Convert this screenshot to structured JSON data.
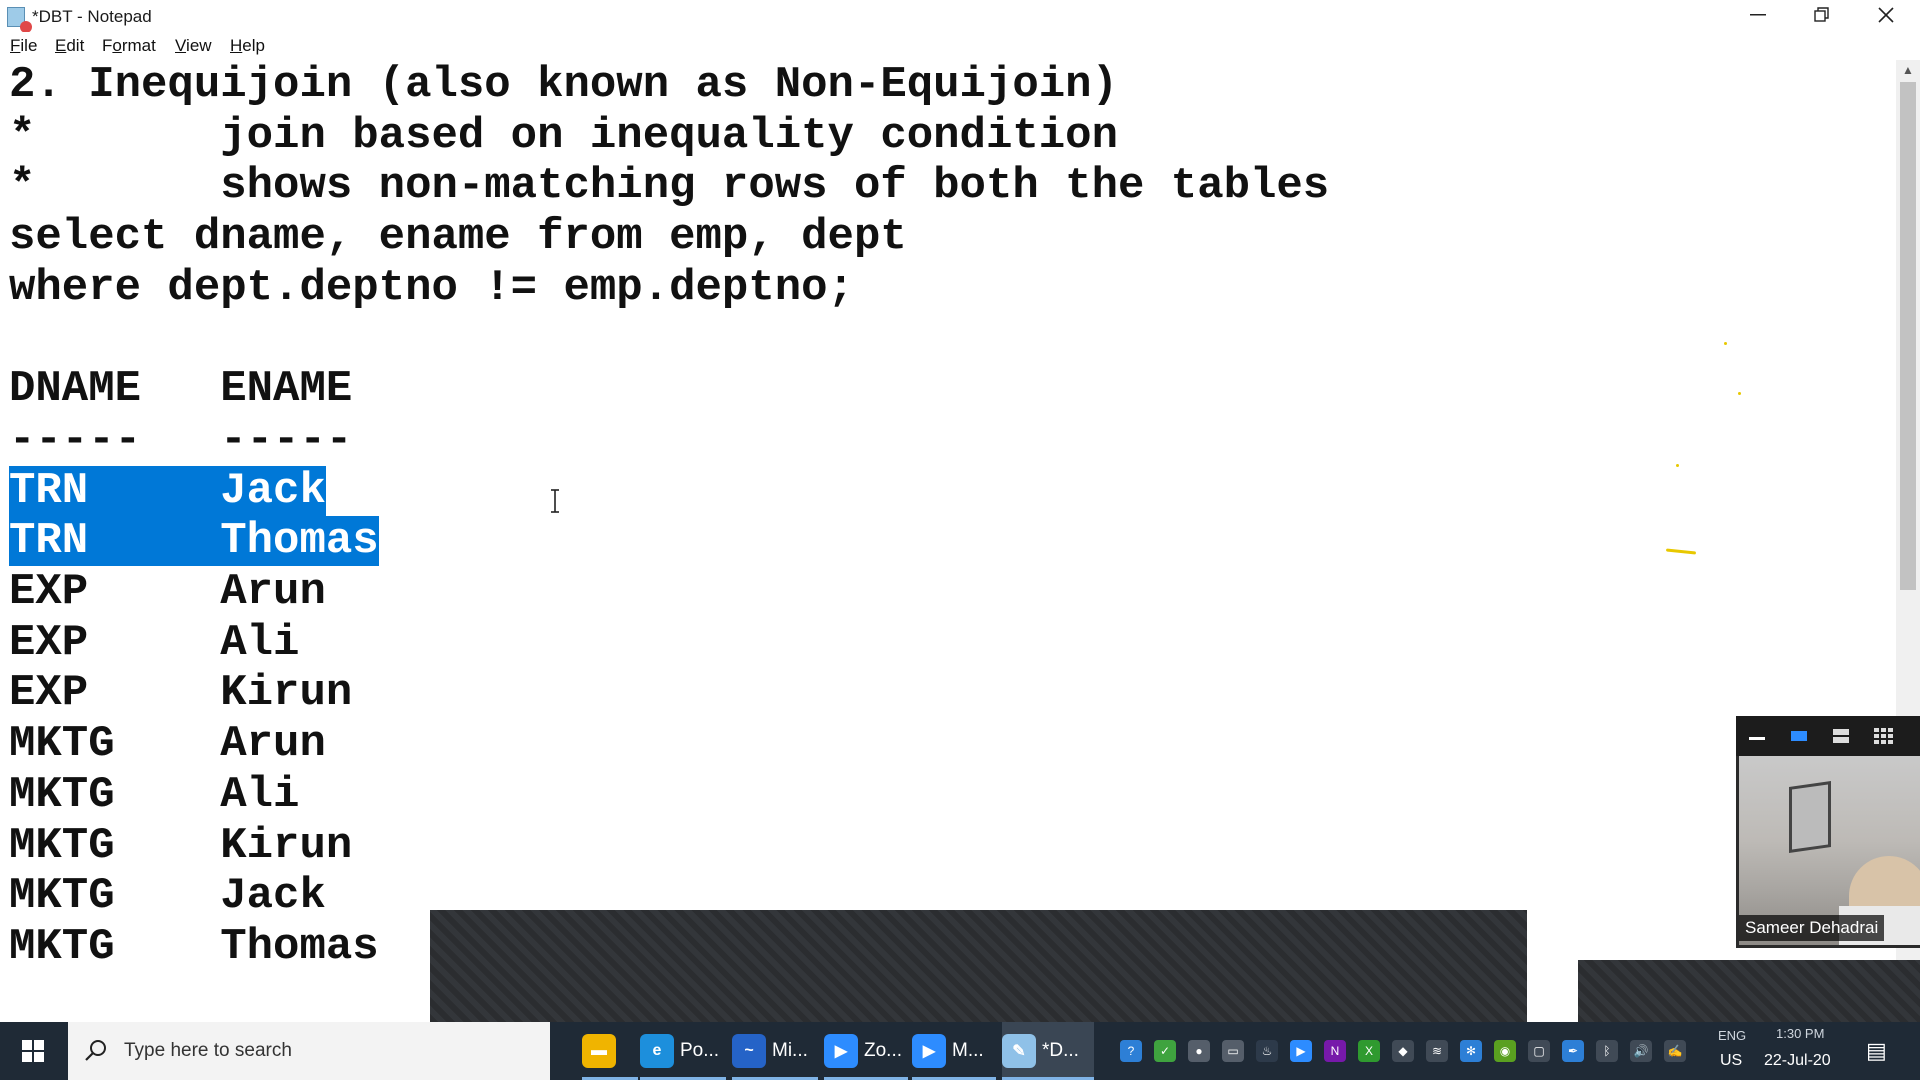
{
  "window": {
    "title": "*DBT - Notepad",
    "minimize_glyph": "—",
    "restore_glyph": "❐",
    "close_glyph": "✕"
  },
  "menu": [
    {
      "prefix": "",
      "hotkey": "F",
      "rest": "ile"
    },
    {
      "prefix": "",
      "hotkey": "E",
      "rest": "dit"
    },
    {
      "prefix": "F",
      "hotkey": "o",
      "rest": "rmat"
    },
    {
      "prefix": "",
      "hotkey": "V",
      "rest": "iew"
    },
    {
      "prefix": "",
      "hotkey": "H",
      "rest": "elp"
    }
  ],
  "editor": {
    "lines": [
      "2. Inequijoin (also known as Non-Equijoin)",
      "*       join based on inequality condition",
      "*       shows non-matching rows of both the tables",
      "select dname, ename from emp, dept",
      "where dept.deptno != emp.deptno;",
      "",
      "DNAME   ENAME",
      "-----   -----",
      "TRN     Jack",
      "TRN     Thomas",
      "EXP     Arun",
      "EXP     Ali",
      "EXP     Kirun",
      "MKTG    Arun",
      "MKTG    Ali",
      "MKTG    Kirun",
      "MKTG    Jack",
      "MKTG    Thomas"
    ],
    "selected_lines": [
      8,
      9
    ],
    "selection_color": "#0078d7"
  },
  "video": {
    "participant_name": "Sameer Dehadrai"
  },
  "taskbar": {
    "search_placeholder": "Type here to search",
    "apps": [
      {
        "name": "file-explorer",
        "label": "",
        "color": "#f0b400",
        "glyph": "▬"
      },
      {
        "name": "edge",
        "label": "Po...",
        "color": "#1d8fdc",
        "glyph": "e"
      },
      {
        "name": "whiteboard",
        "label": "Mi...",
        "color": "#2563c7",
        "glyph": "~"
      },
      {
        "name": "zoom",
        "label": "Zo...",
        "color": "#2d8cff",
        "glyph": "▶"
      },
      {
        "name": "zoom-meeting",
        "label": "M...",
        "color": "#2d8cff",
        "glyph": "▶"
      },
      {
        "name": "notepad",
        "label": "*D...",
        "color": "#8fc1e8",
        "glyph": "✎"
      }
    ],
    "tray_icons": [
      {
        "name": "help-icon",
        "color": "#2d7fd6",
        "glyph": "?"
      },
      {
        "name": "check-icon",
        "color": "#3fa33f",
        "glyph": "✓"
      },
      {
        "name": "mic-icon",
        "color": "#555e6a",
        "glyph": "●"
      },
      {
        "name": "folder-icon",
        "color": "#555e6a",
        "glyph": "▭"
      },
      {
        "name": "steam-icon",
        "color": "#2d3a4a",
        "glyph": "♨"
      },
      {
        "name": "zoom-tray-icon",
        "color": "#2d8cff",
        "glyph": "▶"
      },
      {
        "name": "onenote-icon",
        "color": "#7719aa",
        "glyph": "N"
      },
      {
        "name": "xbox-icon",
        "color": "#2f9a2f",
        "glyph": "X"
      },
      {
        "name": "shield-icon",
        "color": "#404a56",
        "glyph": "◆"
      },
      {
        "name": "wifi-icon",
        "color": "#404a56",
        "glyph": "≋"
      },
      {
        "name": "snowflake-icon",
        "color": "#2d7fd6",
        "glyph": "✻"
      },
      {
        "name": "nvidia-icon",
        "color": "#5aa020",
        "glyph": "◉"
      },
      {
        "name": "app-tray-icon",
        "color": "#404a56",
        "glyph": "▢"
      },
      {
        "name": "pen-icon",
        "color": "#2d7fd6",
        "glyph": "✒"
      },
      {
        "name": "bluetooth-icon",
        "color": "#404a56",
        "glyph": "ᛒ"
      },
      {
        "name": "volume-icon",
        "color": "#404a56",
        "glyph": "🔊"
      },
      {
        "name": "pen-tray-icon",
        "color": "#404a56",
        "glyph": "✍"
      }
    ],
    "language_top": "ENG",
    "language_bottom": "US",
    "time": "1:30 PM",
    "date": "22-Jul-20",
    "notification_glyph": "▤"
  }
}
